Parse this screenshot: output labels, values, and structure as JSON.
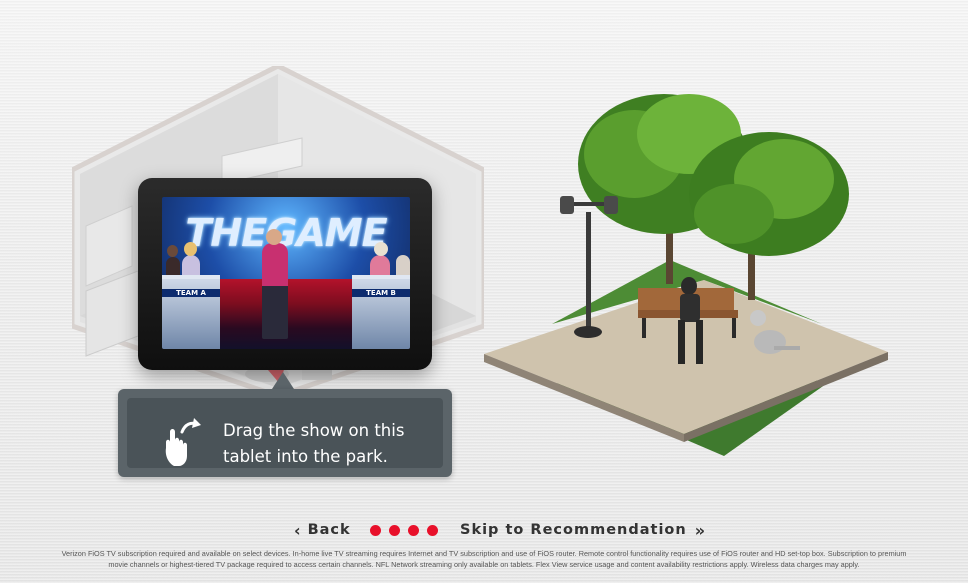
{
  "tablet_screen": {
    "show_title": "THEGAME",
    "podium_left": "TEAM A",
    "podium_right": "TEAM B"
  },
  "tooltip": {
    "icon": "hand-pointer-drag-icon",
    "line1": "Drag the show on this",
    "line2": "tablet into the park."
  },
  "nav": {
    "back_label": "Back",
    "back_icon": "chevron-left-icon",
    "progress_dots": 4,
    "dot_color": "#e8102a",
    "skip_label": "Skip to Recommendation",
    "skip_icon": "double-chevron-right-icon"
  },
  "disclaimer": {
    "line1": "Verizon FiOS TV subscription required and available on select devices. In-home live TV streaming requires Internet and TV subscription and use of FiOS router. Remote control functionality requires use of FiOS router and HD set-top box. Subscription to premium",
    "line2": "movie channels or highest-tiered TV package required to access certain channels. NFL Network streaming only available on tablets. Flex View service usage and content availability restrictions apply. Wireless data charges may apply."
  }
}
